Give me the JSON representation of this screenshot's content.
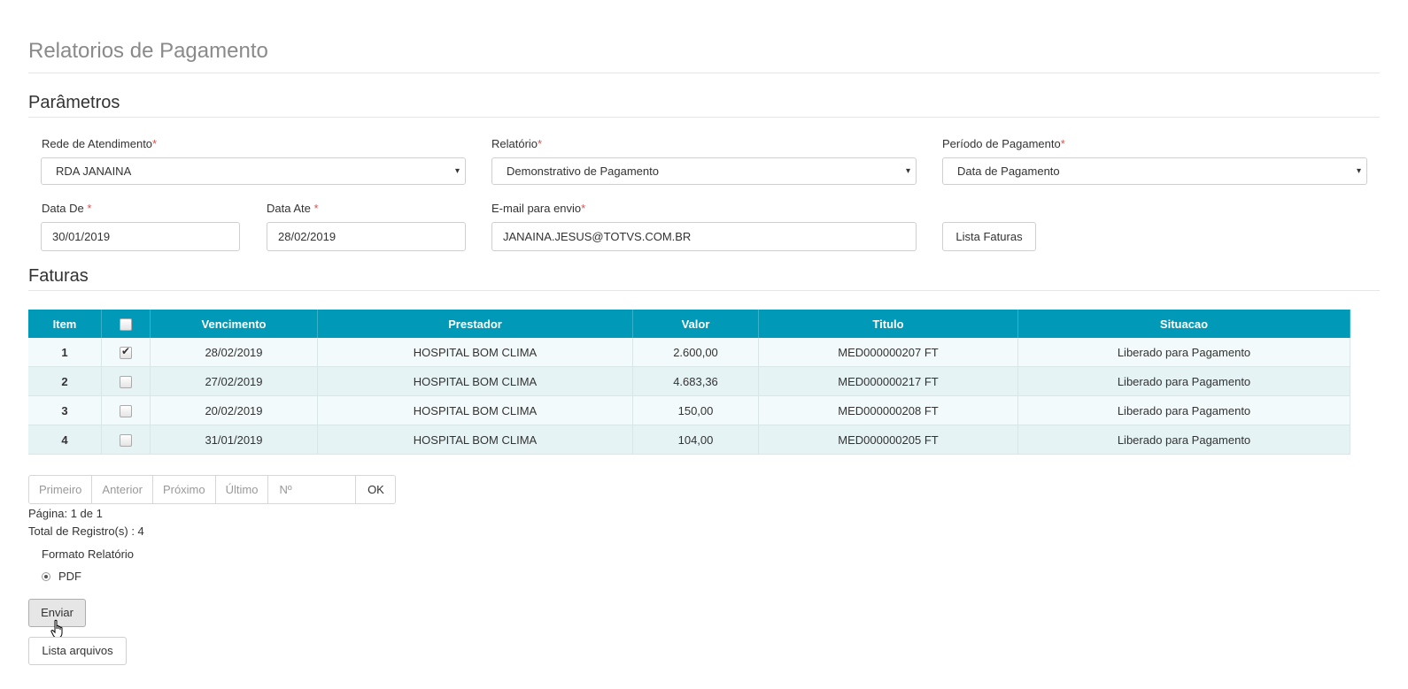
{
  "page_title": "Relatorios de Pagamento",
  "params": {
    "section_title": "Parâmetros",
    "rede": {
      "label": "Rede de Atendimento",
      "required_mark": "*",
      "value": "RDA JANAINA"
    },
    "relatorio": {
      "label": "Relatório",
      "required_mark": "*",
      "value": "Demonstrativo de Pagamento"
    },
    "periodo": {
      "label": "Período de Pagamento",
      "required_mark": "*",
      "value": "Data de Pagamento"
    },
    "data_de": {
      "label": "Data De ",
      "required_mark": "*",
      "value": "30/01/2019"
    },
    "data_ate": {
      "label": "Data Ate ",
      "required_mark": "*",
      "value": "28/02/2019"
    },
    "email": {
      "label": "E-mail para envio",
      "required_mark": "*",
      "value": "JANAINA.JESUS@TOTVS.COM.BR"
    },
    "lista_faturas_label": "Lista Faturas",
    "caret": "▾"
  },
  "faturas": {
    "section_title": "Faturas",
    "columns": [
      "Item",
      "",
      "Vencimento",
      "Prestador",
      "Valor",
      "Titulo",
      "Situacao"
    ],
    "rows": [
      {
        "item": "1",
        "checked": true,
        "vencimento": "28/02/2019",
        "prestador": "HOSPITAL BOM CLIMA",
        "valor": "2.600,00",
        "titulo": "MED000000207 FT",
        "situacao": "Liberado para Pagamento"
      },
      {
        "item": "2",
        "checked": false,
        "vencimento": "27/02/2019",
        "prestador": "HOSPITAL BOM CLIMA",
        "valor": "4.683,36",
        "titulo": "MED000000217 FT",
        "situacao": "Liberado para Pagamento"
      },
      {
        "item": "3",
        "checked": false,
        "vencimento": "20/02/2019",
        "prestador": "HOSPITAL BOM CLIMA",
        "valor": "150,00",
        "titulo": "MED000000208 FT",
        "situacao": "Liberado para Pagamento"
      },
      {
        "item": "4",
        "checked": false,
        "vencimento": "31/01/2019",
        "prestador": "HOSPITAL BOM CLIMA",
        "valor": "104,00",
        "titulo": "MED000000205 FT",
        "situacao": "Liberado para Pagamento"
      }
    ]
  },
  "pager": {
    "primeiro": "Primeiro",
    "anterior": "Anterior",
    "proximo": "Próximo",
    "ultimo": "Último",
    "page_input_placeholder": "Nº",
    "ok": "OK",
    "pagina_text": "Página: 1 de 1",
    "total_text": "Total de Registro(s) : 4"
  },
  "formato": {
    "label": "Formato Relatório",
    "option_pdf": "PDF",
    "selected": "PDF"
  },
  "actions": {
    "enviar": "Enviar",
    "lista_arquivos": "Lista arquivos"
  }
}
